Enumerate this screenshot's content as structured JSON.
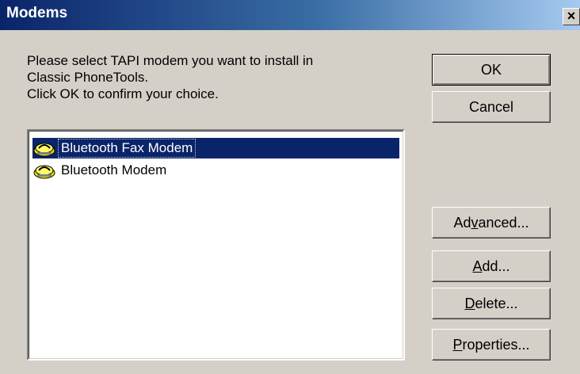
{
  "window": {
    "title": "Modems",
    "close_glyph": "×"
  },
  "instructions": {
    "line1": "Please select TAPI modem you want to install in",
    "line2": "Classic PhoneTools.",
    "line3": "Click OK to confirm your choice."
  },
  "modems": [
    {
      "label": "Bluetooth Fax Modem",
      "icon": "modem-icon",
      "selected": true
    },
    {
      "label": "Bluetooth Modem",
      "icon": "modem-icon",
      "selected": false
    }
  ],
  "buttons": {
    "ok": "OK",
    "cancel": "Cancel",
    "advanced": {
      "pre": "Ad",
      "mnemonic": "v",
      "post": "anced..."
    },
    "add": {
      "pre": "",
      "mnemonic": "A",
      "post": "dd..."
    },
    "delete": {
      "pre": "",
      "mnemonic": "D",
      "post": "elete..."
    },
    "properties": {
      "pre": "",
      "mnemonic": "P",
      "post": "roperties..."
    }
  },
  "colors": {
    "selection": "#0a246a",
    "face": "#d4d0c8",
    "titlebar_start": "#0a246a"
  }
}
